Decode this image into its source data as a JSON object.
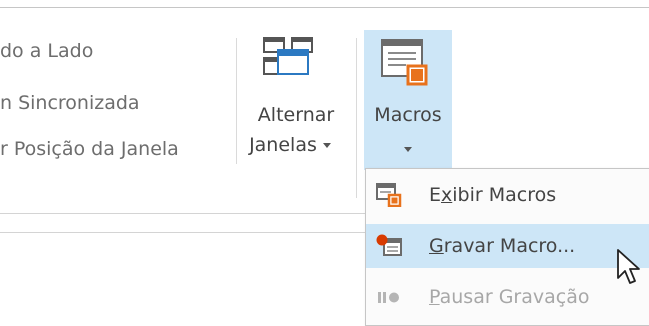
{
  "window_group": {
    "items": [
      {
        "label": "do a Lado"
      },
      {
        "label": "n Sincronizada"
      },
      {
        "label": "r Posição da Janela"
      }
    ]
  },
  "switch_windows": {
    "line1": "Alternar",
    "line2": "Janelas"
  },
  "macros": {
    "label": "Macros",
    "menu": [
      {
        "pre": "E",
        "accel": "x",
        "post": "ibir Macros",
        "state": "normal",
        "icon": "view-macros-icon"
      },
      {
        "pre": "",
        "accel": "G",
        "post": "ravar Macro...",
        "state": "highlighted",
        "icon": "record-macro-icon"
      },
      {
        "pre": "",
        "accel": "P",
        "post": "ausar Gravação",
        "state": "disabled",
        "icon": "pause-recording-icon"
      }
    ]
  },
  "colors": {
    "hover_bg": "#cde6f7",
    "accent_orange": "#e8721c",
    "record_red": "#d83b01"
  }
}
